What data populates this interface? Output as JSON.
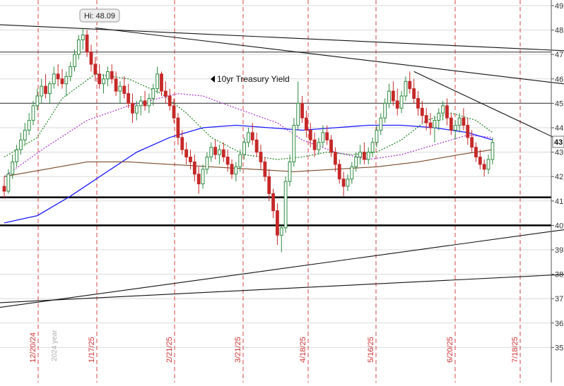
{
  "chart_data": {
    "type": "candlestick",
    "title": "",
    "annotation": "10yr Treasury Yield",
    "hi_label": "Hi: 48.09",
    "current_value_label": "43",
    "year_label": "2024 year",
    "ylim": [
      34,
      49
    ],
    "y_ticks": [
      "35",
      "36",
      "37",
      "38",
      "39",
      "40",
      "41",
      "42",
      "43",
      "44",
      "45",
      "46",
      "47",
      "48",
      "49"
    ],
    "date_markers": [
      "12/20/24",
      "1/17/25",
      "2/21/25",
      "3/21/25",
      "4/18/25",
      "5/16/25",
      "6/20/25",
      "7/18/25"
    ],
    "horizontal_levels": [
      {
        "value": 47.1,
        "style": "thin"
      },
      {
        "value": 45.0,
        "style": "thin"
      },
      {
        "value": 41.15,
        "style": "thick"
      },
      {
        "value": 40.0,
        "style": "thick"
      }
    ],
    "ohlc": [
      [
        41.6,
        42.0,
        41.1,
        41.4
      ],
      [
        41.4,
        42.3,
        41.3,
        42.1
      ],
      [
        42.1,
        42.9,
        41.9,
        42.6
      ],
      [
        42.6,
        43.3,
        42.4,
        43.1
      ],
      [
        43.1,
        43.8,
        42.9,
        43.5
      ],
      [
        43.5,
        44.2,
        43.3,
        43.9
      ],
      [
        43.9,
        44.6,
        43.7,
        44.3
      ],
      [
        44.3,
        45.1,
        44.1,
        44.9
      ],
      [
        44.9,
        45.6,
        44.7,
        45.3
      ],
      [
        45.3,
        46.0,
        45.0,
        45.7
      ],
      [
        45.7,
        46.2,
        45.2,
        45.4
      ],
      [
        45.4,
        45.9,
        45.0,
        45.8
      ],
      [
        45.8,
        46.5,
        45.6,
        46.2
      ],
      [
        46.2,
        46.6,
        45.7,
        46.0
      ],
      [
        46.0,
        46.4,
        45.6,
        45.8
      ],
      [
        45.8,
        46.3,
        45.3,
        46.1
      ],
      [
        46.1,
        46.7,
        45.9,
        46.5
      ],
      [
        46.5,
        47.2,
        46.3,
        47.0
      ],
      [
        47.0,
        47.8,
        46.8,
        47.6
      ],
      [
        47.6,
        48.09,
        47.2,
        47.8
      ],
      [
        47.8,
        48.0,
        46.9,
        47.1
      ],
      [
        47.1,
        47.4,
        46.3,
        46.6
      ],
      [
        46.6,
        46.9,
        45.9,
        46.2
      ],
      [
        46.2,
        46.6,
        45.6,
        45.8
      ],
      [
        45.8,
        46.2,
        45.4,
        46.0
      ],
      [
        46.0,
        46.5,
        45.7,
        46.3
      ],
      [
        46.3,
        46.6,
        45.8,
        46.0
      ],
      [
        46.0,
        46.3,
        45.3,
        45.5
      ],
      [
        45.5,
        45.9,
        45.0,
        45.7
      ],
      [
        45.7,
        46.1,
        45.2,
        45.4
      ],
      [
        45.4,
        45.8,
        44.8,
        45.0
      ],
      [
        45.0,
        45.4,
        44.2,
        44.6
      ],
      [
        44.6,
        45.1,
        44.3,
        44.9
      ],
      [
        44.9,
        45.3,
        44.5,
        45.1
      ],
      [
        45.1,
        45.5,
        44.7,
        44.9
      ],
      [
        44.9,
        45.4,
        44.6,
        45.2
      ],
      [
        45.2,
        45.8,
        44.9,
        45.6
      ],
      [
        45.6,
        46.5,
        45.4,
        46.2
      ],
      [
        46.2,
        46.3,
        45.3,
        45.5
      ],
      [
        45.5,
        45.9,
        45.0,
        45.3
      ],
      [
        45.3,
        45.6,
        44.7,
        44.9
      ],
      [
        44.9,
        45.2,
        44.2,
        44.4
      ],
      [
        44.4,
        44.6,
        43.3,
        43.6
      ],
      [
        43.6,
        43.9,
        42.9,
        43.1
      ],
      [
        43.1,
        43.4,
        42.5,
        42.8
      ],
      [
        42.8,
        43.1,
        42.3,
        42.6
      ],
      [
        42.6,
        42.9,
        41.8,
        42.1
      ],
      [
        42.1,
        42.4,
        41.3,
        41.7
      ],
      [
        41.7,
        42.5,
        41.5,
        42.3
      ],
      [
        42.3,
        43.0,
        42.1,
        42.8
      ],
      [
        42.8,
        43.4,
        42.6,
        43.2
      ],
      [
        43.2,
        43.5,
        42.7,
        42.9
      ],
      [
        42.9,
        43.3,
        42.5,
        43.1
      ],
      [
        43.1,
        43.4,
        42.6,
        42.8
      ],
      [
        42.8,
        43.1,
        42.2,
        42.5
      ],
      [
        42.5,
        42.7,
        41.9,
        42.1
      ],
      [
        42.1,
        42.6,
        41.8,
        42.4
      ],
      [
        42.4,
        43.1,
        42.2,
        42.9
      ],
      [
        42.9,
        43.6,
        42.7,
        43.4
      ],
      [
        43.4,
        44.0,
        43.2,
        43.8
      ],
      [
        43.8,
        44.2,
        43.3,
        43.5
      ],
      [
        43.5,
        43.8,
        42.8,
        43.0
      ],
      [
        43.0,
        43.3,
        42.3,
        42.6
      ],
      [
        42.6,
        42.8,
        41.8,
        42.0
      ],
      [
        42.0,
        42.3,
        41.0,
        41.3
      ],
      [
        41.3,
        41.5,
        40.3,
        40.6
      ],
      [
        40.6,
        40.9,
        39.2,
        39.6
      ],
      [
        39.6,
        40.0,
        38.9,
        39.9
      ],
      [
        39.9,
        42.0,
        39.7,
        41.8
      ],
      [
        41.8,
        42.9,
        41.6,
        42.6
      ],
      [
        42.6,
        44.4,
        42.4,
        44.1
      ],
      [
        44.1,
        45.9,
        43.9,
        45.0
      ],
      [
        45.0,
        45.3,
        44.2,
        44.4
      ],
      [
        44.4,
        44.7,
        43.6,
        43.9
      ],
      [
        43.9,
        44.2,
        43.2,
        43.5
      ],
      [
        43.5,
        43.8,
        42.8,
        43.1
      ],
      [
        43.1,
        43.6,
        42.9,
        43.4
      ],
      [
        43.4,
        44.1,
        43.2,
        43.8
      ],
      [
        43.8,
        44.1,
        43.3,
        43.5
      ],
      [
        43.5,
        43.7,
        42.8,
        43.0
      ],
      [
        43.0,
        43.2,
        42.2,
        42.5
      ],
      [
        42.5,
        42.7,
        41.7,
        41.9
      ],
      [
        41.9,
        42.2,
        41.2,
        41.6
      ],
      [
        41.6,
        42.1,
        41.4,
        41.9
      ],
      [
        41.9,
        42.6,
        41.7,
        42.4
      ],
      [
        42.4,
        43.0,
        42.2,
        42.8
      ],
      [
        42.8,
        43.3,
        42.5,
        43.0
      ],
      [
        43.0,
        43.4,
        42.5,
        42.7
      ],
      [
        42.7,
        43.2,
        42.5,
        43.0
      ],
      [
        43.0,
        43.6,
        42.8,
        43.4
      ],
      [
        43.4,
        44.1,
        43.2,
        43.9
      ],
      [
        43.9,
        44.6,
        43.7,
        44.4
      ],
      [
        44.4,
        45.2,
        44.2,
        45.0
      ],
      [
        45.0,
        45.8,
        44.8,
        45.5
      ],
      [
        45.5,
        45.9,
        44.9,
        45.1
      ],
      [
        45.1,
        45.6,
        44.5,
        44.8
      ],
      [
        44.8,
        45.5,
        44.6,
        45.3
      ],
      [
        45.3,
        46.1,
        45.1,
        45.9
      ],
      [
        45.9,
        46.3,
        45.4,
        45.6
      ],
      [
        45.6,
        46.0,
        45.0,
        45.2
      ],
      [
        45.2,
        45.5,
        44.5,
        44.8
      ],
      [
        44.8,
        45.1,
        44.2,
        44.5
      ],
      [
        44.5,
        44.8,
        43.9,
        44.2
      ],
      [
        44.2,
        44.6,
        43.7,
        44.0
      ],
      [
        44.0,
        44.5,
        43.4,
        44.3
      ],
      [
        44.3,
        44.8,
        43.9,
        44.6
      ],
      [
        44.6,
        45.1,
        44.3,
        44.9
      ],
      [
        44.9,
        45.2,
        44.1,
        44.4
      ],
      [
        44.4,
        44.6,
        43.7,
        43.9
      ],
      [
        43.9,
        44.3,
        43.5,
        44.1
      ],
      [
        44.1,
        44.6,
        43.8,
        44.4
      ],
      [
        44.4,
        44.8,
        43.9,
        44.1
      ],
      [
        44.1,
        44.4,
        43.3,
        43.6
      ],
      [
        43.6,
        43.9,
        43.0,
        43.2
      ],
      [
        43.2,
        43.4,
        42.6,
        42.8
      ],
      [
        42.8,
        43.1,
        42.3,
        42.5
      ],
      [
        42.5,
        42.7,
        42.0,
        42.3
      ],
      [
        42.3,
        42.9,
        42.1,
        42.7
      ],
      [
        42.7,
        43.6,
        42.5,
        43.4
      ]
    ],
    "moving_averages": [
      {
        "style": "green-dashed",
        "values": [
          [
            0,
            42.8
          ],
          [
            8,
            43.6
          ],
          [
            14,
            45.2
          ],
          [
            22,
            46.2
          ],
          [
            30,
            46.0
          ],
          [
            38,
            45.4
          ],
          [
            44,
            44.6
          ],
          [
            50,
            43.6
          ],
          [
            58,
            42.9
          ],
          [
            66,
            42.7
          ],
          [
            72,
            42.8
          ],
          [
            78,
            43.0
          ],
          [
            84,
            42.9
          ],
          [
            90,
            43.0
          ],
          [
            96,
            43.5
          ],
          [
            102,
            44.3
          ],
          [
            108,
            44.6
          ],
          [
            114,
            44.3
          ],
          [
            118,
            43.8
          ]
        ]
      },
      {
        "style": "purple-dashed",
        "values": [
          [
            0,
            42.0
          ],
          [
            10,
            43.2
          ],
          [
            20,
            44.3
          ],
          [
            30,
            44.9
          ],
          [
            42,
            45.4
          ],
          [
            48,
            45.3
          ],
          [
            56,
            44.8
          ],
          [
            66,
            44.2
          ],
          [
            72,
            43.5
          ],
          [
            80,
            43.0
          ],
          [
            88,
            42.7
          ],
          [
            96,
            42.9
          ],
          [
            104,
            43.3
          ],
          [
            112,
            43.7
          ],
          [
            118,
            43.6
          ]
        ]
      },
      {
        "style": "blue",
        "values": [
          [
            0,
            40.1
          ],
          [
            8,
            40.4
          ],
          [
            16,
            41.2
          ],
          [
            24,
            42.1
          ],
          [
            32,
            43.0
          ],
          [
            40,
            43.6
          ],
          [
            48,
            44.0
          ],
          [
            56,
            44.1
          ],
          [
            64,
            44.0
          ],
          [
            72,
            43.9
          ],
          [
            80,
            44.0
          ],
          [
            88,
            44.1
          ],
          [
            96,
            44.1
          ],
          [
            104,
            44.0
          ],
          [
            112,
            43.8
          ],
          [
            118,
            43.5
          ]
        ]
      },
      {
        "style": "brown",
        "values": [
          [
            0,
            42.0
          ],
          [
            10,
            42.3
          ],
          [
            20,
            42.6
          ],
          [
            30,
            42.6
          ],
          [
            40,
            42.5
          ],
          [
            50,
            42.4
          ],
          [
            60,
            42.3
          ],
          [
            70,
            42.2
          ],
          [
            80,
            42.3
          ],
          [
            90,
            42.4
          ],
          [
            100,
            42.6
          ],
          [
            110,
            42.9
          ],
          [
            118,
            43.1
          ]
        ]
      }
    ],
    "trendlines": [
      {
        "from": [
          -5,
          48.25
        ],
        "to": [
          140,
          47.12
        ]
      },
      {
        "from": [
          22,
          48.09
        ],
        "to": [
          140,
          45.7
        ]
      },
      {
        "from": [
          99,
          46.3
        ],
        "to": [
          146,
          42.55
        ]
      },
      {
        "from": [
          -5,
          36.55
        ],
        "to": [
          160,
          40.4
        ]
      },
      {
        "from": [
          -5,
          36.8
        ],
        "to": [
          160,
          38.2
        ]
      }
    ],
    "grid": true,
    "legend": "none"
  }
}
